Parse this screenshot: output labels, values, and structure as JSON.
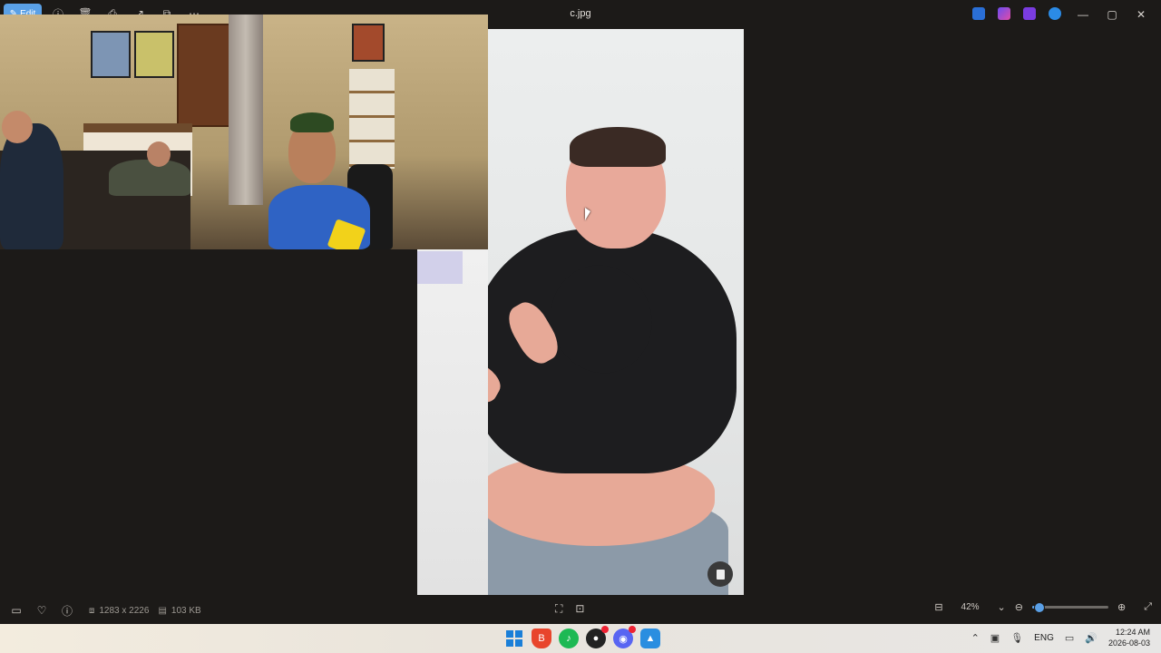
{
  "window": {
    "title": "c.jpg",
    "edit_label": "Edit"
  },
  "toolbar": {
    "icons": [
      "edit-icon",
      "info-circle-icon",
      "delete-icon",
      "print-icon",
      "share-icon",
      "crop-icon",
      "more-icon"
    ]
  },
  "title_apps": [
    "draw-app-icon",
    "copilot-icon",
    "clipchamp-icon",
    "onedrive-icon"
  ],
  "window_controls": {
    "minimize": "—",
    "maximize": "▢",
    "close": "✕"
  },
  "status": {
    "dimensions": "1283 x 2226",
    "size": "103 KB",
    "zoom": "42%",
    "zoom_fraction": 0.08
  },
  "taskbar": {
    "apps": [
      {
        "name": "start",
        "color": "#1a7fd8"
      },
      {
        "name": "brave",
        "color": "#e8452c"
      },
      {
        "name": "spotify",
        "color": "#1db954"
      },
      {
        "name": "app-3",
        "color": "#222222"
      },
      {
        "name": "discord",
        "color": "#5865f2"
      },
      {
        "name": "photos",
        "color": "#2a8ee0"
      }
    ],
    "language": "ENG",
    "time": "12:24 AM",
    "date": "2026-08-03"
  },
  "colors": {
    "accent": "#5aa0e6",
    "background": "#1c1a18"
  }
}
